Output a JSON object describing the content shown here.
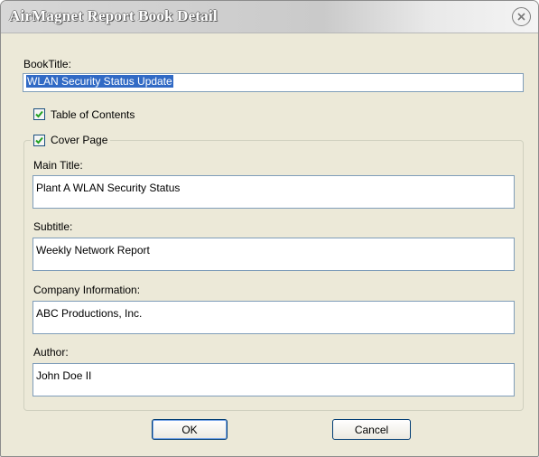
{
  "window": {
    "title": "AirMagnet Report Book Detail"
  },
  "book_title": {
    "label": "BookTitle:",
    "value": "WLAN Security Status Update"
  },
  "table_of_contents": {
    "label": "Table of Contents",
    "checked": true
  },
  "cover_page": {
    "label": "Cover Page",
    "checked": true,
    "fields": {
      "main_title": {
        "label": "Main Title:",
        "value": "Plant A WLAN Security Status"
      },
      "subtitle": {
        "label": "Subtitle:",
        "value": "Weekly Network Report"
      },
      "company": {
        "label": "Company Information:",
        "value": "ABC Productions, Inc."
      },
      "author": {
        "label": "Author:",
        "value": "John Doe II"
      }
    }
  },
  "buttons": {
    "ok": "OK",
    "cancel": "Cancel"
  },
  "icons": {
    "close": "close-icon",
    "checkmark": "checkmark-icon"
  }
}
